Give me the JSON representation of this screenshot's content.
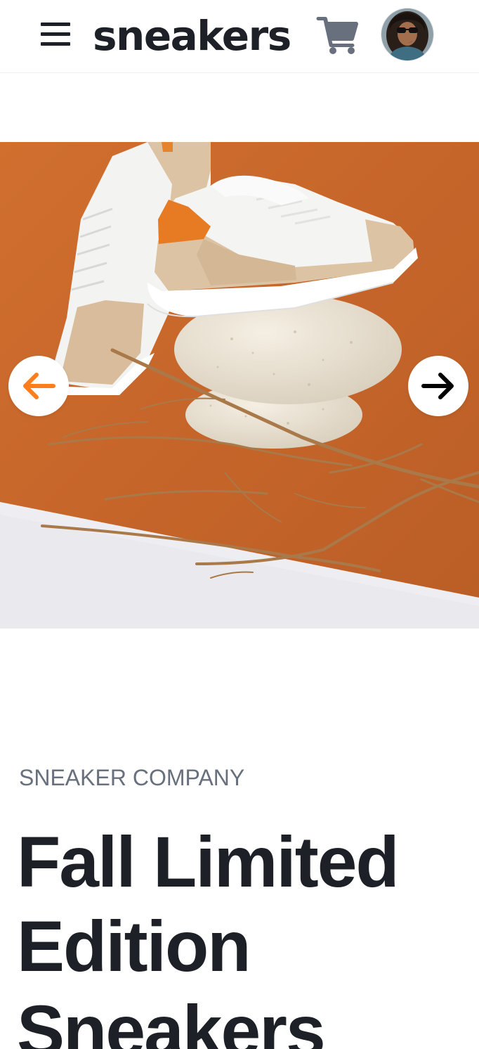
{
  "header": {
    "menu_icon": "hamburger-menu-icon",
    "logo": "sneakers",
    "cart_icon": "cart-icon",
    "avatar": "user-avatar"
  },
  "gallery": {
    "prev_icon": "arrow-left-icon",
    "next_icon": "arrow-right-icon",
    "prev_color": "#ff7e1b",
    "next_color": "#000000",
    "image": "sneakers-on-stones-product-photo"
  },
  "product": {
    "company": "SNEAKER COMPANY",
    "title": "Fall Limited Edition Sneakers"
  },
  "colors": {
    "accent": "#ff7e1b",
    "dark": "#1d2026",
    "muted": "#68707d",
    "backdrop": "#c86a2c"
  }
}
